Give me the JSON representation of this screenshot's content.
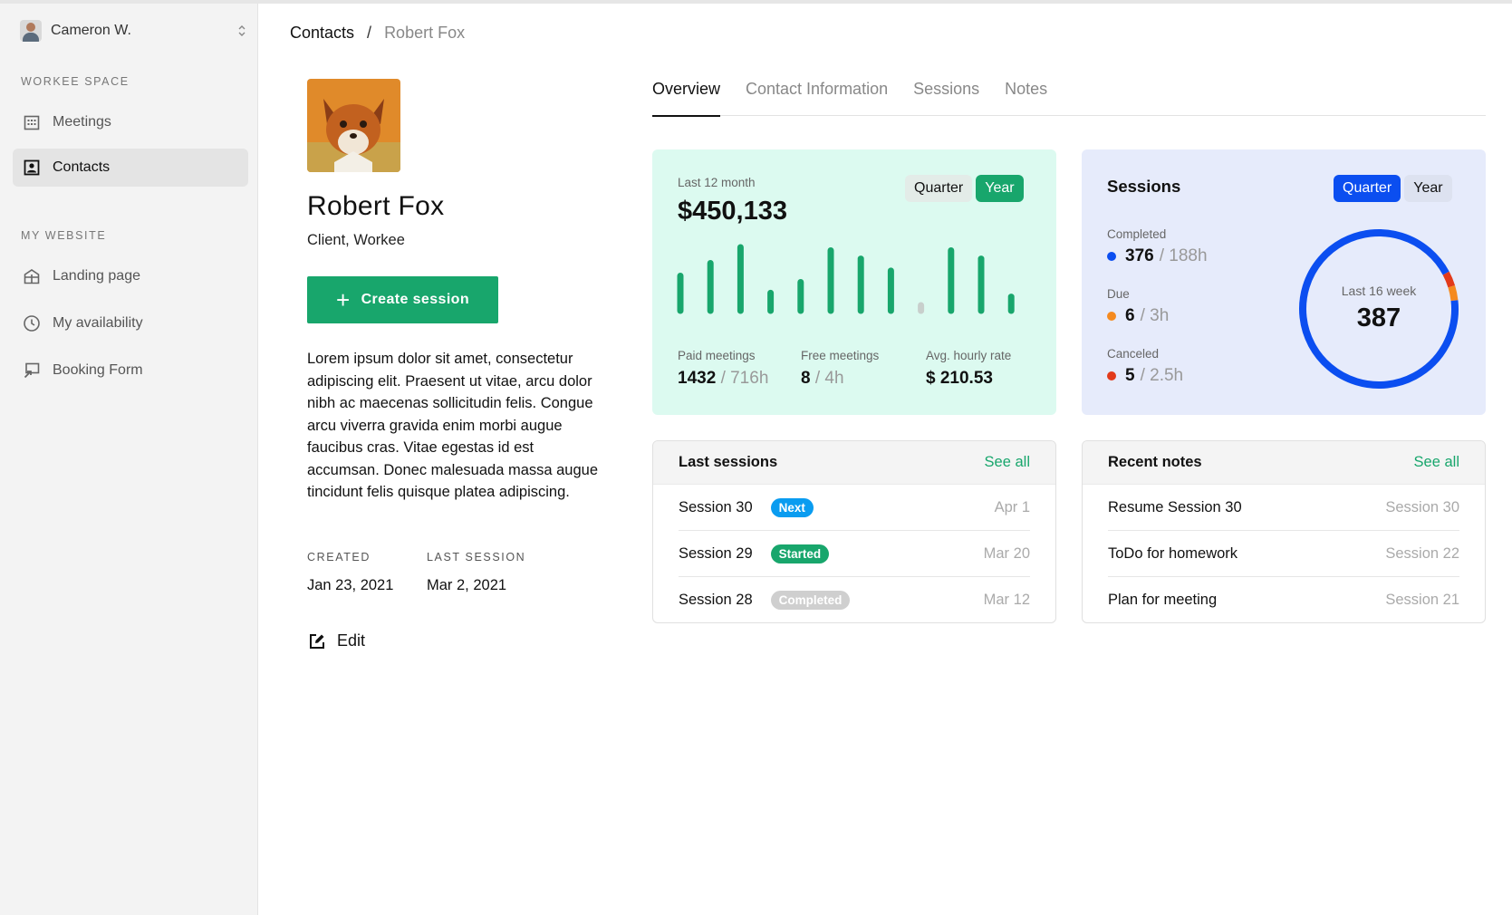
{
  "user": {
    "name": "Cameron W."
  },
  "sidebar": {
    "sections": [
      {
        "label": "WORKEE SPACE"
      },
      {
        "label": "MY WEBSITE"
      }
    ],
    "items": [
      {
        "label": "Meetings",
        "icon": "calendar-icon"
      },
      {
        "label": "Contacts",
        "icon": "contact-card-icon",
        "active": true
      },
      {
        "label": "Landing page",
        "icon": "storefront-icon"
      },
      {
        "label": "My availability",
        "icon": "clock-icon"
      },
      {
        "label": "Booking Form",
        "icon": "booking-form-icon"
      }
    ]
  },
  "breadcrumb": {
    "parent": "Contacts",
    "separator": "/",
    "current": "Robert Fox"
  },
  "profile": {
    "name": "Robert Fox",
    "role": "Client, Workee",
    "create_button": "Create session",
    "description": "Lorem ipsum dolor sit amet, consectetur adipiscing elit. Praesent ut vitae, arcu dolor nibh ac maecenas sollicitudin felis. Congue arcu viverra gravida enim morbi augue faucibus cras. Vitae egestas id est accumsan. Donec malesuada massa augue tincidunt felis quisque platea adipiscing.",
    "created_label": "CREATED",
    "created_value": "Jan 23, 2021",
    "last_session_label": "LAST SESSION",
    "last_session_value": "Mar 2, 2021",
    "edit_label": "Edit"
  },
  "tabs": [
    {
      "label": "Overview",
      "active": true
    },
    {
      "label": "Contact Information"
    },
    {
      "label": "Sessions"
    },
    {
      "label": "Notes"
    }
  ],
  "revenue": {
    "period_label": "Last 12 month",
    "total": "$450,133",
    "toggle": {
      "quarter": "Quarter",
      "year": "Year",
      "selected": "Year"
    },
    "stats": [
      {
        "label": "Paid meetings",
        "value": "1432",
        "sub": "/ 716h"
      },
      {
        "label": "Free meetings",
        "value": "8",
        "sub": "/ 4h"
      },
      {
        "label": "Avg. hourly rate",
        "value": "$ 210.53",
        "sub": ""
      }
    ],
    "colors": {
      "bar": "#18a66c",
      "empty": "#c8cfcc",
      "card": "#dcfaf0"
    }
  },
  "chart_data": {
    "type": "bar",
    "categories": [
      "1",
      "2",
      "3",
      "4",
      "5",
      "6",
      "7",
      "8",
      "9",
      "10",
      "11",
      "12"
    ],
    "values": [
      5.5,
      7.5,
      10,
      2.8,
      4.5,
      9.5,
      8.2,
      6.3,
      0.8,
      9.5,
      8.2,
      2.2
    ],
    "ylim": [
      0,
      10
    ],
    "title": "",
    "xlabel": "",
    "ylabel": ""
  },
  "sessions": {
    "title": "Sessions",
    "toggle": {
      "quarter": "Quarter",
      "year": "Year",
      "selected": "Quarter"
    },
    "stats": [
      {
        "label": "Completed",
        "value": "376",
        "sub": "/ 188h",
        "color": "#0b4ef0"
      },
      {
        "label": "Due",
        "value": "6",
        "sub": "/ 3h",
        "color": "#f58a1f"
      },
      {
        "label": "Canceled",
        "value": "5",
        "sub": "/ 2.5h",
        "color": "#e23a1a"
      }
    ],
    "donut": {
      "label": "Last 16 week",
      "value": "387",
      "segments": [
        {
          "name": "Completed",
          "value": 376,
          "color": "#0b4ef0"
        },
        {
          "name": "Due",
          "value": 6,
          "color": "#f58a1f"
        },
        {
          "name": "Canceled",
          "value": 5,
          "color": "#e23a1a"
        }
      ]
    }
  },
  "last_sessions": {
    "title": "Last sessions",
    "see_all": "See all",
    "rows": [
      {
        "name": "Session 30",
        "badge": "Next",
        "badge_color": "#0a9cf0",
        "date": "Apr 1"
      },
      {
        "name": "Session 29",
        "badge": "Started",
        "badge_color": "#18a66c",
        "date": "Mar 20"
      },
      {
        "name": "Session 28",
        "badge": "Completed",
        "badge_color": "#cfcfcf",
        "date": "Mar 12"
      }
    ]
  },
  "recent_notes": {
    "title": "Recent notes",
    "see_all": "See all",
    "rows": [
      {
        "name": "Resume Session 30",
        "session": "Session 30"
      },
      {
        "name": "ToDo for homework",
        "session": "Session 22"
      },
      {
        "name": "Plan for meeting",
        "session": "Session 21"
      }
    ]
  }
}
